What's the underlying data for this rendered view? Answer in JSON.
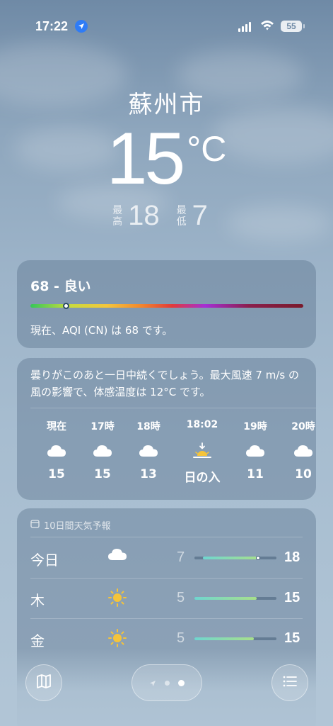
{
  "status_bar": {
    "time": "17:22",
    "battery": "55"
  },
  "location": {
    "city": "蘇州市",
    "temperature": "15",
    "unit": "°C",
    "high_label": "最高",
    "high": "18",
    "low_label": "最低",
    "low": "7"
  },
  "aqi": {
    "title": "68 - 良い",
    "level": 0.13,
    "description": "現在、AQI (CN) は 68 です。"
  },
  "hourly": {
    "summary": "曇りがこのあと一日中続くでしょう。最大風速 7 m/s の風の影響で、体感温度は 12°C です。",
    "items": [
      {
        "hour": "現在",
        "icon": "cloud-icon",
        "temp": "15"
      },
      {
        "hour": "17時",
        "icon": "cloud-icon",
        "temp": "15"
      },
      {
        "hour": "18時",
        "icon": "cloud-icon",
        "temp": "13"
      },
      {
        "hour": "18:02",
        "icon": "sunset-icon",
        "temp": "日の入"
      },
      {
        "hour": "19時",
        "icon": "cloud-icon",
        "temp": "11"
      },
      {
        "hour": "20時",
        "icon": "cloud-icon",
        "temp": "10"
      }
    ]
  },
  "daily": {
    "header": "10日間天気予報",
    "days": [
      {
        "name": "今日",
        "icon": "cloud-icon",
        "low": "7",
        "high": "18",
        "range_start": 0.1,
        "range_end": 0.8,
        "current": 0.78
      },
      {
        "name": "木",
        "icon": "sun-icon",
        "low": "5",
        "high": "15",
        "range_start": 0.0,
        "range_end": 0.76
      },
      {
        "name": "金",
        "icon": "sun-icon",
        "low": "5",
        "high": "15",
        "range_start": 0.0,
        "range_end": 0.72
      }
    ]
  },
  "colors": {
    "sun": "#f5c43a",
    "accent": "#2f7cf6"
  }
}
